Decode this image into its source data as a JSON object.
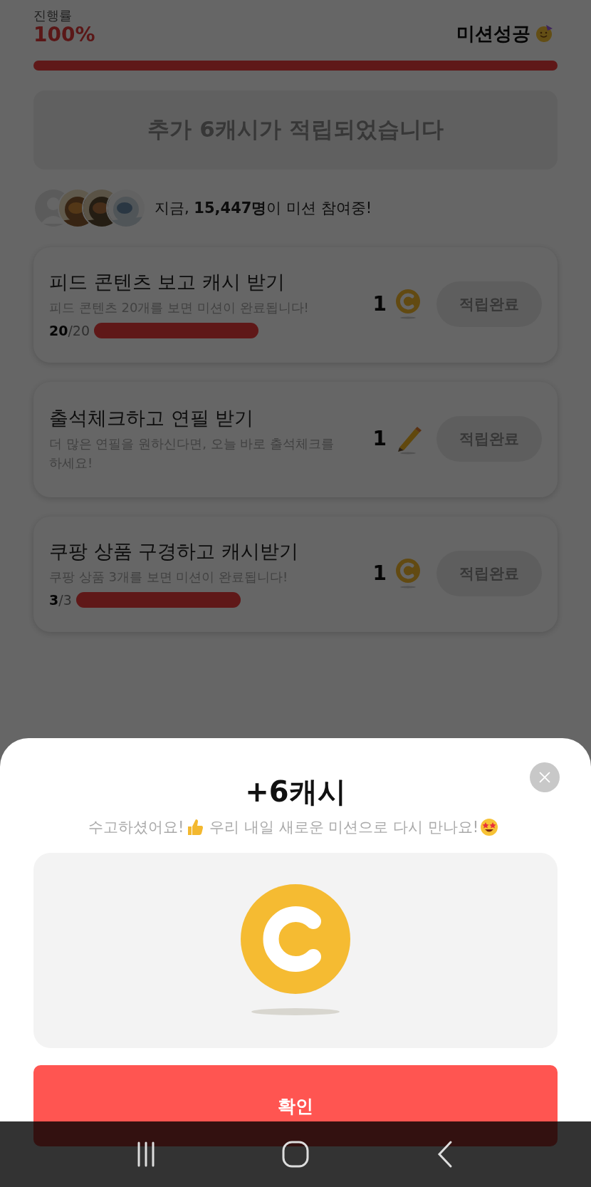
{
  "progress": {
    "label": "진행률",
    "percent": "100%",
    "status": "미션성공",
    "level": 1
  },
  "banner": {
    "text": "추가 6캐시가 적립되었습니다"
  },
  "participants": {
    "text": "지금, **15,447명**이 미션 참여중!",
    "avatars": [
      {
        "kind": "silhouette"
      },
      {
        "kind": "picture"
      },
      {
        "kind": "picture"
      },
      {
        "kind": "picture"
      }
    ]
  },
  "missions": [
    {
      "title": "피드 콘텐츠 보고 캐시 받기",
      "description": "피드 콘텐츠 20개를 보면 미션이 완료됩니다!",
      "progress": {
        "done": "20",
        "total": "/20",
        "level": 1
      },
      "reward": {
        "count": "1",
        "kind": "coin"
      },
      "button": "적립완료",
      "disabled": true
    },
    {
      "title": "출석체크하고 연필 받기",
      "description": "더 많은 연필을 원하신다면, 오늘 바로 출석체크를 하세요!",
      "reward": {
        "count": "1",
        "kind": "pencil"
      },
      "button": "적립완료",
      "disabled": true
    },
    {
      "title": "쿠팡 상품 구경하고 캐시받기",
      "description": "쿠팡 상품 3개를 보면 미션이 완료됩니다!",
      "progress": {
        "done": "3",
        "total": "/3",
        "level": 1
      },
      "reward": {
        "count": "1",
        "kind": "coin"
      },
      "button": "적립완료",
      "disabled": true
    }
  ],
  "sheet": {
    "title": "+6캐시",
    "subtitle": [
      "수고하셨어요!",
      "우리 내일 새로운 미션으로 다시 만나요!"
    ],
    "confirm": "확인"
  }
}
